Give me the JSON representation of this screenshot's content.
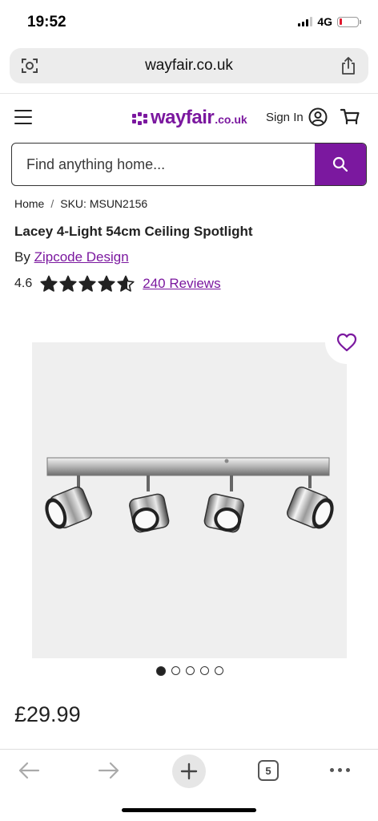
{
  "status": {
    "time": "19:52",
    "network": "4G"
  },
  "browser": {
    "url": "wayfair.co.uk",
    "tab_count": "5"
  },
  "header": {
    "logo_word": "wayfair",
    "logo_tld": ".co.uk",
    "signin_label": "Sign In"
  },
  "search": {
    "placeholder": "Find anything home..."
  },
  "breadcrumb": {
    "home": "Home",
    "separator": "/",
    "sku": "SKU: MSUN2156"
  },
  "product": {
    "title": "Lacey 4-Light 54cm Ceiling Spotlight",
    "by_prefix": "By",
    "brand": "Zipcode Design",
    "rating": "4.6",
    "rating_stars": 4.6,
    "reviews_label": "240 Reviews",
    "price": "£29.99",
    "image_count": 5,
    "active_image": 1
  },
  "colors": {
    "brand": "#7b189f",
    "battery_low": "#e0192f"
  }
}
